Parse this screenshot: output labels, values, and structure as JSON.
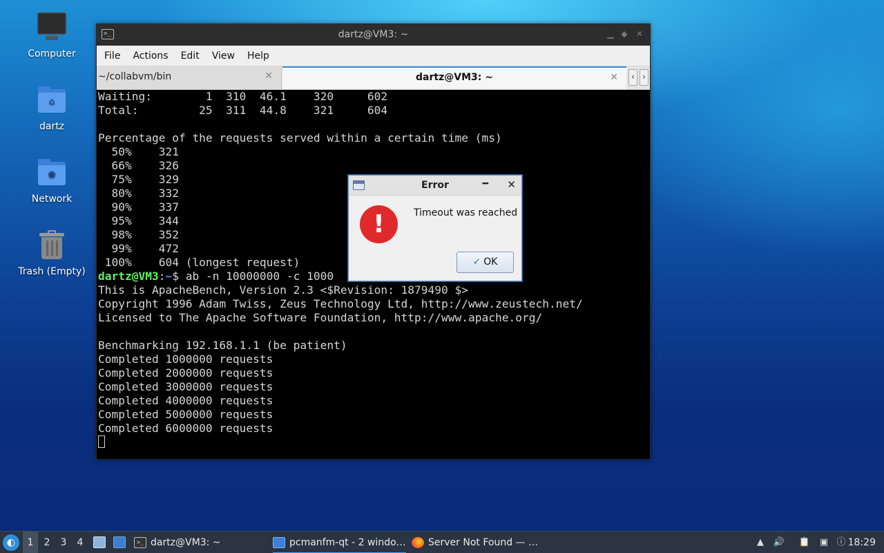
{
  "desktop": {
    "icons": [
      {
        "label": "Computer"
      },
      {
        "label": "dartz"
      },
      {
        "label": "Network"
      },
      {
        "label": "Trash (Empty)"
      }
    ]
  },
  "terminal": {
    "window_title": "dartz@VM3: ~",
    "menu": [
      "File",
      "Actions",
      "Edit",
      "View",
      "Help"
    ],
    "tabs": [
      {
        "label": "~/collabvm/bin"
      },
      {
        "label": "dartz@VM3: ~"
      }
    ],
    "lines": {
      "l1": "Waiting:        1  310  46.1    320     602",
      "l2": "Total:         25  311  44.8    321     604",
      "l3": "",
      "l4": "Percentage of the requests served within a certain time (ms)",
      "l5": "  50%    321",
      "l6": "  66%    326",
      "l7": "  75%    329",
      "l8": "  80%    332",
      "l9": "  90%    337",
      "l10": "  95%    344",
      "l11": "  98%    352",
      "l12": "  99%    472",
      "l13": " 100%    604 (longest request)",
      "prompt_user": "dartz@VM3",
      "prompt_sep": ":",
      "prompt_path": "~",
      "prompt_cmd": "$ ab -n 10000000 -c 1000",
      "l15": "This is ApacheBench, Version 2.3 <$Revision: 1879490 $>",
      "l16": "Copyright 1996 Adam Twiss, Zeus Technology Ltd, http://www.zeustech.net/",
      "l17": "Licensed to The Apache Software Foundation, http://www.apache.org/",
      "l18": "",
      "l19": "Benchmarking 192.168.1.1 (be patient)",
      "l20": "Completed 1000000 requests",
      "l21": "Completed 2000000 requests",
      "l22": "Completed 3000000 requests",
      "l23": "Completed 4000000 requests",
      "l24": "Completed 5000000 requests",
      "l25": "Completed 6000000 requests"
    }
  },
  "dialog": {
    "title": "Error",
    "message": "Timeout was reached",
    "ok_label": "OK"
  },
  "taskbar": {
    "workspaces": [
      "1",
      "2",
      "3",
      "4"
    ],
    "tasks": [
      {
        "label": "dartz@VM3: ~"
      },
      {
        "label": "pcmanfm-qt - 2 windo…"
      },
      {
        "label": "Server Not Found — …"
      }
    ],
    "clock": "18:29"
  }
}
